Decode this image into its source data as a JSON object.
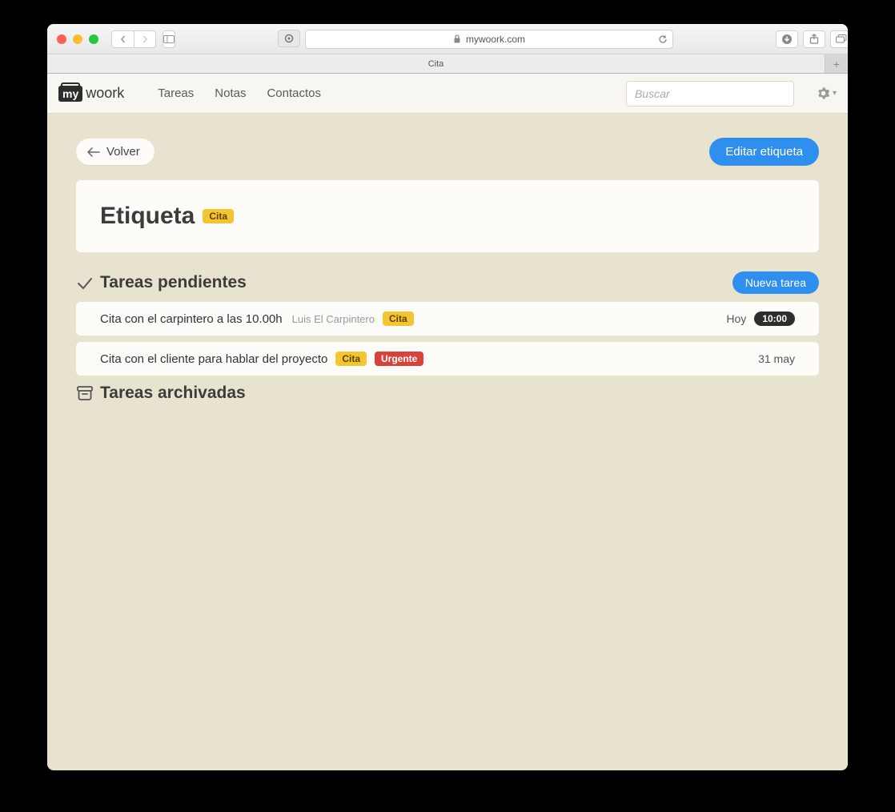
{
  "browser": {
    "url": "mywoork.com",
    "tab_title": "Cita"
  },
  "nav": {
    "logo_prefix": "my",
    "logo_suffix": "woork",
    "links": [
      "Tareas",
      "Notas",
      "Contactos"
    ],
    "search_placeholder": "Buscar"
  },
  "actions": {
    "back_label": "Volver",
    "edit_label": "Editar etiqueta",
    "new_task_label": "Nueva tarea"
  },
  "header": {
    "title": "Etiqueta",
    "tag": "Cita"
  },
  "sections": {
    "pending_title": "Tareas pendientes",
    "archived_title": "Tareas archivadas"
  },
  "tasks": [
    {
      "title": "Cita con el carpintero a las 10.00h",
      "assignee": "Luis El Carpintero",
      "tags": [
        {
          "label": "Cita",
          "style": "yellow"
        }
      ],
      "date_label": "Hoy",
      "time_badge": "10:00"
    },
    {
      "title": "Cita con el cliente para hablar del proyecto",
      "assignee": "",
      "tags": [
        {
          "label": "Cita",
          "style": "yellow"
        },
        {
          "label": "Urgente",
          "style": "red"
        }
      ],
      "date_label": "31 may",
      "time_badge": ""
    }
  ]
}
